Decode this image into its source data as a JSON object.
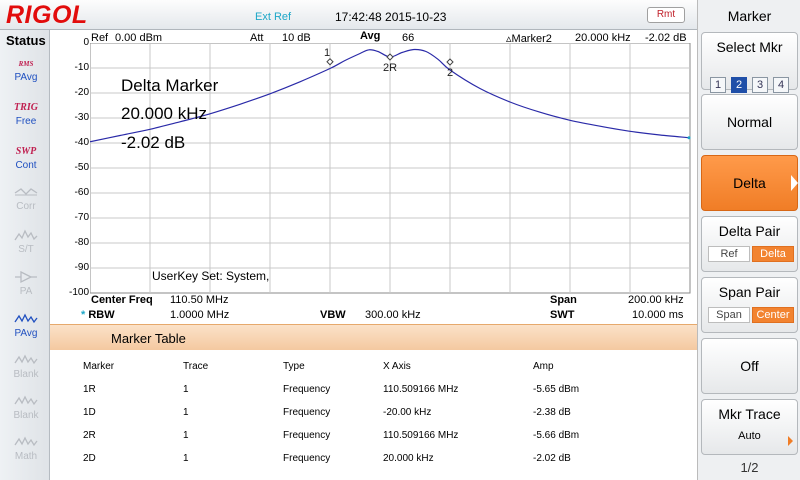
{
  "header": {
    "brand": "RIGOL",
    "ext_ref": "Ext Ref",
    "datetime": "17:42:48 2015-10-23",
    "remote_badge": "Rmt"
  },
  "status_panel": {
    "title": "Status",
    "items": [
      {
        "glyph": "RMS",
        "label": "PAvg",
        "state": "active"
      },
      {
        "glyph": "TRIG",
        "label": "Free",
        "state": "active"
      },
      {
        "glyph": "SWP",
        "label": "Cont",
        "state": "active"
      },
      {
        "glyph": "corr-icon",
        "label": "Corr",
        "state": "disabled"
      },
      {
        "glyph": "st-icon",
        "label": "S/T",
        "state": "disabled"
      },
      {
        "glyph": "pa-icon",
        "label": "PA",
        "state": "disabled"
      },
      {
        "glyph": "pavg-trace-icon",
        "label": "PAvg",
        "state": "active"
      },
      {
        "glyph": "blank-trace-icon",
        "label": "Blank",
        "state": "disabled"
      },
      {
        "glyph": "blank-trace-icon",
        "label": "Blank",
        "state": "disabled"
      },
      {
        "glyph": "math-trace-icon",
        "label": "Math",
        "state": "disabled"
      }
    ]
  },
  "plot_header": {
    "ref_label": "Ref",
    "ref_value": "0.00 dBm",
    "att_label": "Att",
    "att_value": "10 dB",
    "avg_label": "Avg",
    "avg_value": "66",
    "marker_label": "Marker2",
    "marker_freq": "20.000 kHz",
    "marker_amp": "-2.02 dB"
  },
  "overlay": {
    "title": "Delta Marker",
    "freq": "20.000 kHz",
    "amp": "-2.02 dB",
    "userkey": "UserKey Set:   System,"
  },
  "chart_data": {
    "type": "line",
    "ylim": [
      -100,
      0
    ],
    "y_ticks": [
      "0",
      "-10",
      "-20",
      "-30",
      "-40",
      "-50",
      "-60",
      "-70",
      "-80",
      "-90",
      "-100"
    ],
    "xlim": [
      10.5,
      210.5
    ],
    "x_unit": "MHz",
    "grid": true,
    "series": [
      {
        "color": "#2a2aa8",
        "x": [
          10.5,
          20.5,
          30.5,
          40.5,
          50.5,
          60.5,
          70.5,
          80.5,
          90.5,
          95.5,
          100.5,
          103.5,
          106.5,
          110.5,
          114.5,
          118.5,
          122.5,
          126.5,
          130.5,
          140.5,
          150.5,
          160.5,
          170.5,
          180.5,
          190.5,
          200.5,
          210.5
        ],
        "y": [
          -39.5,
          -37,
          -34.5,
          -31.5,
          -28.3,
          -24.5,
          -20.3,
          -15.5,
          -10.2,
          -7,
          -4.2,
          -2.7,
          -3.4,
          -5.6,
          -3.8,
          -2.6,
          -3.4,
          -6.5,
          -10.8,
          -18.2,
          -23.6,
          -27.7,
          -30.9,
          -33.3,
          -35.3,
          -36.8,
          -37.9
        ]
      }
    ],
    "markers": [
      {
        "label": "1",
        "x": 90.5,
        "y": -7.5
      },
      {
        "label": "2R",
        "x": 110.5,
        "y": -5.6
      },
      {
        "label": "2",
        "x": 130.5,
        "y": -7.6
      }
    ]
  },
  "settings": {
    "center_freq_label": "Center Freq",
    "center_freq_value": "110.50 MHz",
    "rbw_label": "RBW",
    "rbw_value": "1.0000 MHz",
    "vbw_label": "VBW",
    "vbw_value": "300.00 kHz",
    "span_label": "Span",
    "span_value": "200.00 kHz",
    "swt_label": "SWT",
    "swt_value": "10.000 ms"
  },
  "marker_table": {
    "title": "Marker Table",
    "columns": [
      "Marker",
      "Trace",
      "Type",
      "X Axis",
      "Amp"
    ],
    "rows": [
      [
        "1R",
        "1",
        "Frequency",
        "110.509166 MHz",
        "-5.65 dBm"
      ],
      [
        "1D",
        "1",
        "Frequency",
        "-20.00 kHz",
        "-2.38 dB"
      ],
      [
        "2R",
        "1",
        "Frequency",
        "110.509166 MHz",
        "-5.66 dBm"
      ],
      [
        "2D",
        "1",
        "Frequency",
        "20.000 kHz",
        "-2.02 dB"
      ]
    ]
  },
  "softkeys": {
    "title": "Marker",
    "select_mkr": {
      "label": "Select Mkr",
      "options": [
        "1",
        "2",
        "3",
        "4"
      ],
      "selected": "2"
    },
    "normal": "Normal",
    "delta": "Delta",
    "delta_pair": {
      "label": "Delta Pair",
      "ref": "Ref",
      "delta": "Delta"
    },
    "span_pair": {
      "label": "Span Pair",
      "span": "Span",
      "center": "Center"
    },
    "off": "Off",
    "mkr_trace": {
      "label": "Mkr Trace",
      "value": "Auto"
    },
    "page": "1/2"
  },
  "colors": {
    "accent": "#f07d26",
    "brand": "#e20c0c",
    "trace": "#2a2aa8",
    "selected": "#1f4fa8"
  }
}
